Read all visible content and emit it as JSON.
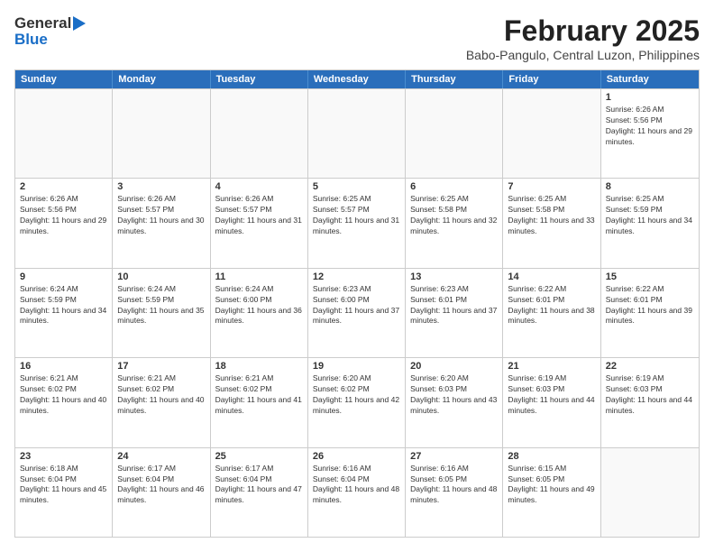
{
  "logo": {
    "general": "General",
    "blue": "Blue"
  },
  "title": "February 2025",
  "subtitle": "Babo-Pangulo, Central Luzon, Philippines",
  "header_days": [
    "Sunday",
    "Monday",
    "Tuesday",
    "Wednesday",
    "Thursday",
    "Friday",
    "Saturday"
  ],
  "rows": [
    [
      {
        "day": "",
        "info": ""
      },
      {
        "day": "",
        "info": ""
      },
      {
        "day": "",
        "info": ""
      },
      {
        "day": "",
        "info": ""
      },
      {
        "day": "",
        "info": ""
      },
      {
        "day": "",
        "info": ""
      },
      {
        "day": "1",
        "info": "Sunrise: 6:26 AM\nSunset: 5:56 PM\nDaylight: 11 hours and 29 minutes."
      }
    ],
    [
      {
        "day": "2",
        "info": "Sunrise: 6:26 AM\nSunset: 5:56 PM\nDaylight: 11 hours and 29 minutes."
      },
      {
        "day": "3",
        "info": "Sunrise: 6:26 AM\nSunset: 5:57 PM\nDaylight: 11 hours and 30 minutes."
      },
      {
        "day": "4",
        "info": "Sunrise: 6:26 AM\nSunset: 5:57 PM\nDaylight: 11 hours and 31 minutes."
      },
      {
        "day": "5",
        "info": "Sunrise: 6:25 AM\nSunset: 5:57 PM\nDaylight: 11 hours and 31 minutes."
      },
      {
        "day": "6",
        "info": "Sunrise: 6:25 AM\nSunset: 5:58 PM\nDaylight: 11 hours and 32 minutes."
      },
      {
        "day": "7",
        "info": "Sunrise: 6:25 AM\nSunset: 5:58 PM\nDaylight: 11 hours and 33 minutes."
      },
      {
        "day": "8",
        "info": "Sunrise: 6:25 AM\nSunset: 5:59 PM\nDaylight: 11 hours and 34 minutes."
      }
    ],
    [
      {
        "day": "9",
        "info": "Sunrise: 6:24 AM\nSunset: 5:59 PM\nDaylight: 11 hours and 34 minutes."
      },
      {
        "day": "10",
        "info": "Sunrise: 6:24 AM\nSunset: 5:59 PM\nDaylight: 11 hours and 35 minutes."
      },
      {
        "day": "11",
        "info": "Sunrise: 6:24 AM\nSunset: 6:00 PM\nDaylight: 11 hours and 36 minutes."
      },
      {
        "day": "12",
        "info": "Sunrise: 6:23 AM\nSunset: 6:00 PM\nDaylight: 11 hours and 37 minutes."
      },
      {
        "day": "13",
        "info": "Sunrise: 6:23 AM\nSunset: 6:01 PM\nDaylight: 11 hours and 37 minutes."
      },
      {
        "day": "14",
        "info": "Sunrise: 6:22 AM\nSunset: 6:01 PM\nDaylight: 11 hours and 38 minutes."
      },
      {
        "day": "15",
        "info": "Sunrise: 6:22 AM\nSunset: 6:01 PM\nDaylight: 11 hours and 39 minutes."
      }
    ],
    [
      {
        "day": "16",
        "info": "Sunrise: 6:21 AM\nSunset: 6:02 PM\nDaylight: 11 hours and 40 minutes."
      },
      {
        "day": "17",
        "info": "Sunrise: 6:21 AM\nSunset: 6:02 PM\nDaylight: 11 hours and 40 minutes."
      },
      {
        "day": "18",
        "info": "Sunrise: 6:21 AM\nSunset: 6:02 PM\nDaylight: 11 hours and 41 minutes."
      },
      {
        "day": "19",
        "info": "Sunrise: 6:20 AM\nSunset: 6:02 PM\nDaylight: 11 hours and 42 minutes."
      },
      {
        "day": "20",
        "info": "Sunrise: 6:20 AM\nSunset: 6:03 PM\nDaylight: 11 hours and 43 minutes."
      },
      {
        "day": "21",
        "info": "Sunrise: 6:19 AM\nSunset: 6:03 PM\nDaylight: 11 hours and 44 minutes."
      },
      {
        "day": "22",
        "info": "Sunrise: 6:19 AM\nSunset: 6:03 PM\nDaylight: 11 hours and 44 minutes."
      }
    ],
    [
      {
        "day": "23",
        "info": "Sunrise: 6:18 AM\nSunset: 6:04 PM\nDaylight: 11 hours and 45 minutes."
      },
      {
        "day": "24",
        "info": "Sunrise: 6:17 AM\nSunset: 6:04 PM\nDaylight: 11 hours and 46 minutes."
      },
      {
        "day": "25",
        "info": "Sunrise: 6:17 AM\nSunset: 6:04 PM\nDaylight: 11 hours and 47 minutes."
      },
      {
        "day": "26",
        "info": "Sunrise: 6:16 AM\nSunset: 6:04 PM\nDaylight: 11 hours and 48 minutes."
      },
      {
        "day": "27",
        "info": "Sunrise: 6:16 AM\nSunset: 6:05 PM\nDaylight: 11 hours and 48 minutes."
      },
      {
        "day": "28",
        "info": "Sunrise: 6:15 AM\nSunset: 6:05 PM\nDaylight: 11 hours and 49 minutes."
      },
      {
        "day": "",
        "info": ""
      }
    ]
  ]
}
